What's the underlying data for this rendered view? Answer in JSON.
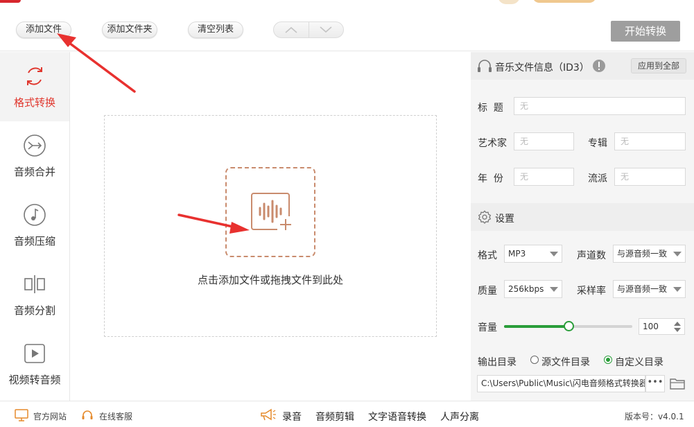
{
  "toolbar": {
    "add_file": "添加文件",
    "add_folder": "添加文件夹",
    "clear_list": "清空列表",
    "start": "开始转换"
  },
  "sidebar": {
    "items": [
      {
        "label": "格式转换",
        "icon": "refresh-icon",
        "active": true
      },
      {
        "label": "音频合并",
        "icon": "merge-icon",
        "active": false
      },
      {
        "label": "音频压缩",
        "icon": "music-note-icon",
        "active": false
      },
      {
        "label": "音频分割",
        "icon": "split-icon",
        "active": false
      },
      {
        "label": "视频转音频",
        "icon": "play-icon",
        "active": false
      }
    ]
  },
  "dropzone": {
    "text": "点击添加文件或拖拽文件到此处"
  },
  "id3": {
    "title": "音乐文件信息（ID3）",
    "apply_all": "应用到全部",
    "fields": {
      "title_label": "标  题",
      "title_placeholder": "无",
      "artist_label": "艺术家",
      "artist_placeholder": "无",
      "album_label": "专辑",
      "album_placeholder": "无",
      "year_label": "年  份",
      "year_placeholder": "无",
      "genre_label": "流派",
      "genre_placeholder": "无"
    }
  },
  "settings": {
    "title": "设置",
    "format_label": "格式",
    "format_value": "MP3",
    "channels_label": "声道数",
    "channels_value": "与源音频一致",
    "quality_label": "质量",
    "quality_value": "256kbps",
    "samplerate_label": "采样率",
    "samplerate_value": "与源音频一致",
    "volume_label": "音量",
    "volume_value": "100",
    "volume_fraction": 0.5,
    "output_label": "输出目录",
    "source_dir_option": "源文件目录",
    "custom_dir_option": "自定义目录",
    "selected_output": "custom",
    "output_path": "C:\\Users\\Public\\Music\\闪电音频格式转换器",
    "browse_label": "•••"
  },
  "footer": {
    "website": "官方网站",
    "support": "在线客服",
    "tools": [
      "录音",
      "音频剪辑",
      "文字语音转换",
      "人声分离"
    ],
    "version": "版本号：v4.0.1"
  },
  "colors": {
    "accent_red": "#e0382f",
    "annotation_red": "#e8312f",
    "slider_green": "#2a9d3a",
    "start_button_gray": "#9e9e9e",
    "drop_icon_brown": "#c98b6d"
  }
}
